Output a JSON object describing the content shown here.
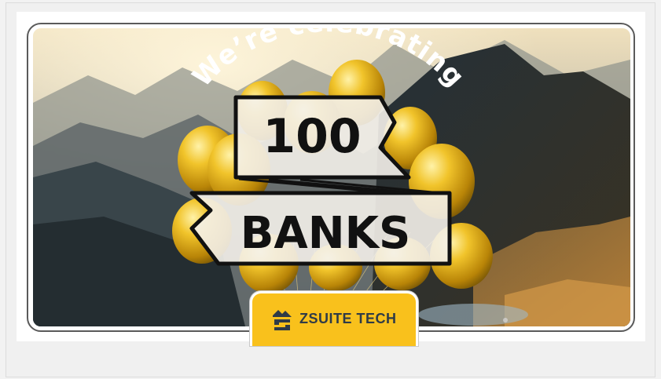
{
  "banner": {
    "arc_text": "We’re celebrating",
    "number": "100",
    "word": "BANKS"
  },
  "logo": {
    "name": "ZSUITE TECH",
    "icon": "zsuite-mountain-logo-icon"
  },
  "colors": {
    "accent_yellow": "#f9c11c",
    "logo_text": "#2f3b47",
    "balloon_gold": "#e5b51a",
    "ribbon_fill": "#f4f1ea",
    "ribbon_stroke": "#111111"
  }
}
